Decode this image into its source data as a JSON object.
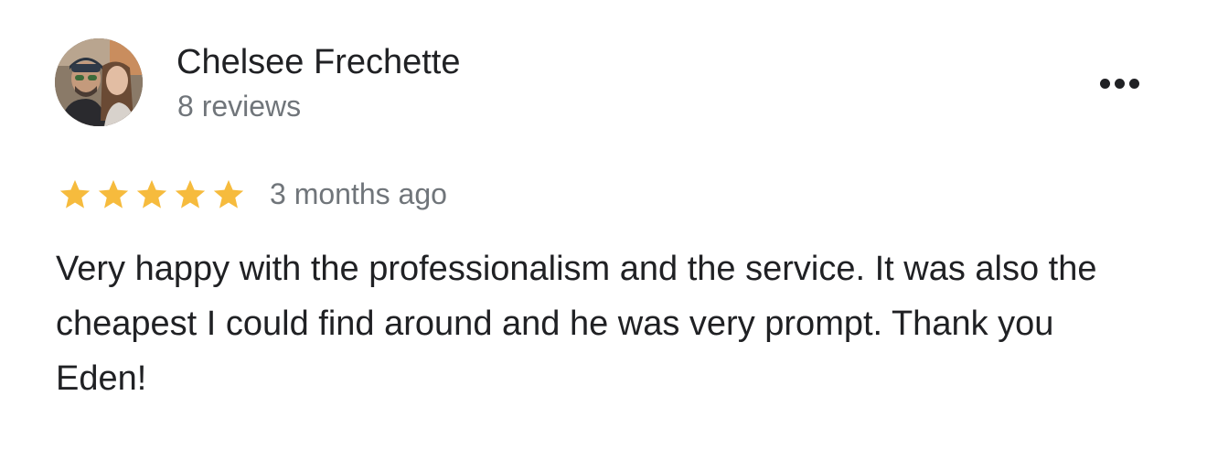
{
  "reviewer": {
    "name": "Chelsee Frechette",
    "review_count": "8 reviews",
    "avatar_icon": "profile-photo"
  },
  "review": {
    "rating": 5,
    "max_rating": 5,
    "date": "3 months ago",
    "text": "Very happy with the professionalism and the service. It was also the cheapest I could find around and he was very prompt. Thank you Eden!"
  },
  "more_button_icon": "more-horizontal-icon",
  "colors": {
    "star": "#F6BB3D",
    "primary_text": "#202124",
    "secondary_text": "#70757A",
    "background": "#FFFFFF"
  }
}
